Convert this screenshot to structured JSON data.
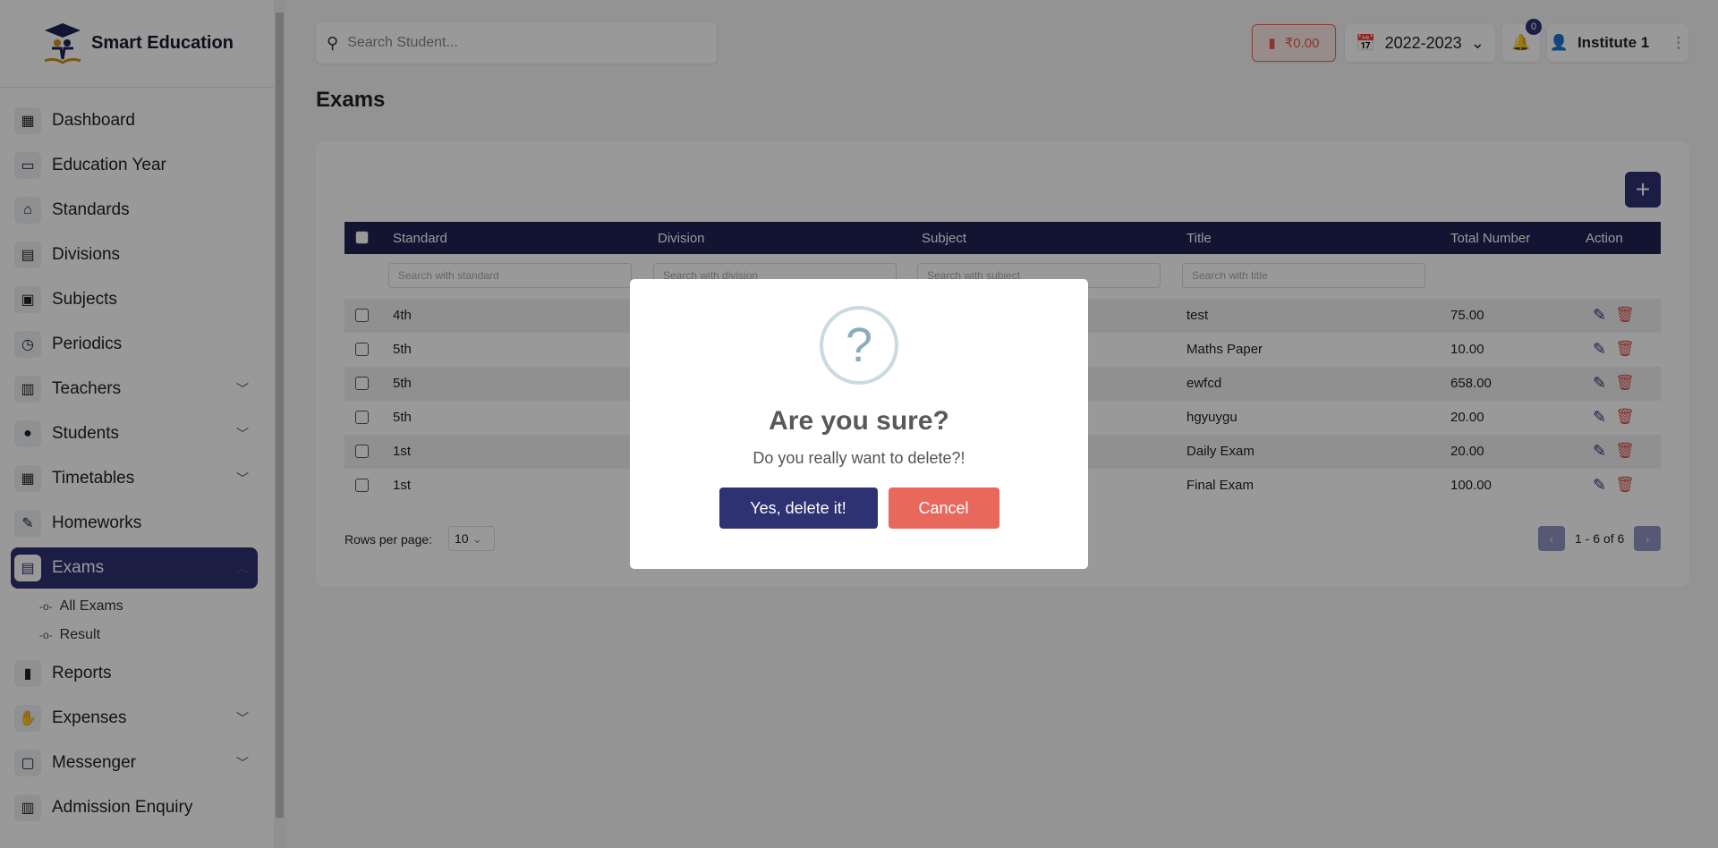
{
  "brand": {
    "name": "Smart Education"
  },
  "sidebar": {
    "items": [
      {
        "label": "Dashboard",
        "icon": "grid-icon"
      },
      {
        "label": "Education Year",
        "icon": "calendar-icon"
      },
      {
        "label": "Standards",
        "icon": "graduation-cap-icon"
      },
      {
        "label": "Divisions",
        "icon": "abc-blocks-icon"
      },
      {
        "label": "Subjects",
        "icon": "book-reader-icon"
      },
      {
        "label": "Periodics",
        "icon": "calendar-clock-icon"
      },
      {
        "label": "Teachers",
        "icon": "teacher-icon",
        "expandable": true
      },
      {
        "label": "Students",
        "icon": "users-icon",
        "expandable": true
      },
      {
        "label": "Timetables",
        "icon": "table-icon",
        "expandable": true
      },
      {
        "label": "Homeworks",
        "icon": "notebook-icon"
      },
      {
        "label": "Exams",
        "icon": "clipboard-icon",
        "expandable": true,
        "active": true
      },
      {
        "label": "Reports",
        "icon": "bar-chart-icon"
      },
      {
        "label": "Expenses",
        "icon": "money-hand-icon",
        "expandable": true
      },
      {
        "label": "Messenger",
        "icon": "message-icon",
        "expandable": true
      },
      {
        "label": "Admission Enquiry",
        "icon": "teacher-board-icon"
      }
    ],
    "exams_sub": [
      "All Exams",
      "Result"
    ]
  },
  "header": {
    "search_placeholder": "Search Student...",
    "wallet": "₹0.00",
    "year": "2022-2023",
    "notifications": "0",
    "user": "Institute 1"
  },
  "page": {
    "title": "Exams"
  },
  "table": {
    "columns": [
      "Standard",
      "Division",
      "Subject",
      "Title",
      "Total Number",
      "Action"
    ],
    "filters": [
      "Search with standard",
      "Search with division",
      "Search with subject",
      "Search with title"
    ],
    "rows": [
      {
        "standard": "4th",
        "title": "test",
        "total": "75.00"
      },
      {
        "standard": "5th",
        "title": "Maths Paper",
        "total": "10.00"
      },
      {
        "standard": "5th",
        "title": "ewfcd",
        "total": "658.00"
      },
      {
        "standard": "5th",
        "title": "hgyuygu",
        "total": "20.00"
      },
      {
        "standard": "1st",
        "title": "Daily Exam",
        "total": "20.00"
      },
      {
        "standard": "1st",
        "title": "Final Exam",
        "total": "100.00"
      }
    ]
  },
  "pagination": {
    "rows_per_page_label": "Rows per page:",
    "rows_per_page": "10",
    "range": "1 - 6 of 6"
  },
  "modal": {
    "icon": "?",
    "title": "Are you sure?",
    "text": "Do you really want to delete?!",
    "confirm": "Yes, delete it!",
    "cancel": "Cancel"
  },
  "colors": {
    "primary": "#2e3172",
    "danger": "#e8685c",
    "header": "#1f2252"
  }
}
